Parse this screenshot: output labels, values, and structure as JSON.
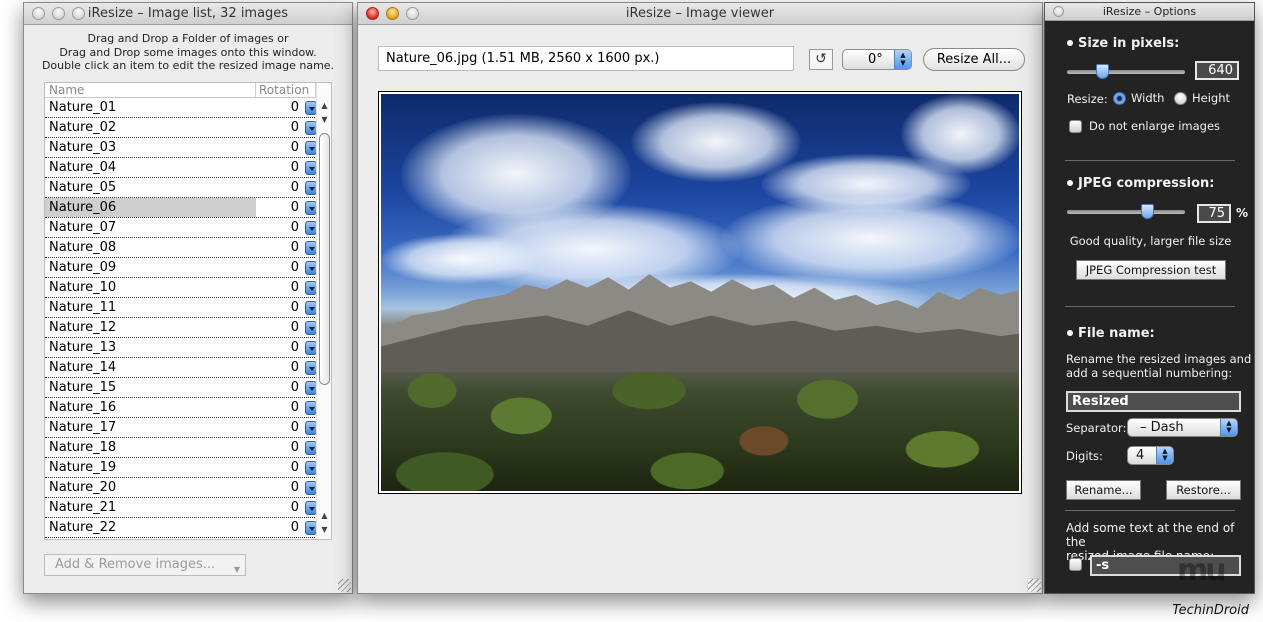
{
  "list_window": {
    "title": "iResize – Image list, 32 images",
    "instructions": [
      "Drag and Drop a Folder of images or",
      "Drag and Drop some images onto this window.",
      "Double click an item to edit the resized image name."
    ],
    "columns": {
      "name": "Name",
      "rotation": "Rotation"
    },
    "rows": [
      {
        "name": "Nature_01",
        "rotation": "0"
      },
      {
        "name": "Nature_02",
        "rotation": "0"
      },
      {
        "name": "Nature_03",
        "rotation": "0"
      },
      {
        "name": "Nature_04",
        "rotation": "0"
      },
      {
        "name": "Nature_05",
        "rotation": "0"
      },
      {
        "name": "Nature_06",
        "rotation": "0"
      },
      {
        "name": "Nature_07",
        "rotation": "0"
      },
      {
        "name": "Nature_08",
        "rotation": "0"
      },
      {
        "name": "Nature_09",
        "rotation": "0"
      },
      {
        "name": "Nature_10",
        "rotation": "0"
      },
      {
        "name": "Nature_11",
        "rotation": "0"
      },
      {
        "name": "Nature_12",
        "rotation": "0"
      },
      {
        "name": "Nature_13",
        "rotation": "0"
      },
      {
        "name": "Nature_14",
        "rotation": "0"
      },
      {
        "name": "Nature_15",
        "rotation": "0"
      },
      {
        "name": "Nature_16",
        "rotation": "0"
      },
      {
        "name": "Nature_17",
        "rotation": "0"
      },
      {
        "name": "Nature_18",
        "rotation": "0"
      },
      {
        "name": "Nature_19",
        "rotation": "0"
      },
      {
        "name": "Nature_20",
        "rotation": "0"
      },
      {
        "name": "Nature_21",
        "rotation": "0"
      },
      {
        "name": "Nature_22",
        "rotation": "0"
      }
    ],
    "selected_row": "Nature_06",
    "add_remove_label": "Add & Remove images...",
    "scroll_up_glyph": "▲",
    "scroll_down_glyph": "▼"
  },
  "viewer_window": {
    "title": "iResize – Image viewer",
    "file_info": "Nature_06.jpg  (1.51 MB, 2560 x 1600 px.)",
    "rotate_icon": "↺",
    "rotation_value": "0°",
    "resize_all_label": "Resize All...",
    "image_description": "Landscape: rocky mountains under a blue sky with white clouds, green shrubs in foreground"
  },
  "options_window": {
    "title": "iResize – Options",
    "size": {
      "heading": "Size in pixels:",
      "slider_fraction": 0.28,
      "value": "640",
      "resize_label": "Resize:",
      "width_label": "Width",
      "height_label": "Height",
      "selected": "Width",
      "no_enlarge_label": "Do not enlarge images",
      "no_enlarge_checked": false
    },
    "jpeg": {
      "heading": "JPEG compression:",
      "slider_fraction": 0.7,
      "value": "75",
      "unit": "%",
      "quality_text": "Good quality, larger file size",
      "test_button": "JPEG Compression test"
    },
    "file_name": {
      "heading": "File name:",
      "description_1": "Rename the resized images and",
      "description_2": "add a sequential numbering:",
      "base_name": "Resized",
      "separator_label": "Separator:",
      "separator_value": "– Dash",
      "digits_label": "Digits:",
      "digits_value": "4",
      "rename_button": "Rename...",
      "restore_button": "Restore..."
    },
    "suffix": {
      "description_1": "Add some text at the end of the",
      "description_2": "resized image file name:",
      "enabled": false,
      "value": "-s"
    }
  },
  "watermark": "TechinDroid",
  "logo_text": "mu"
}
